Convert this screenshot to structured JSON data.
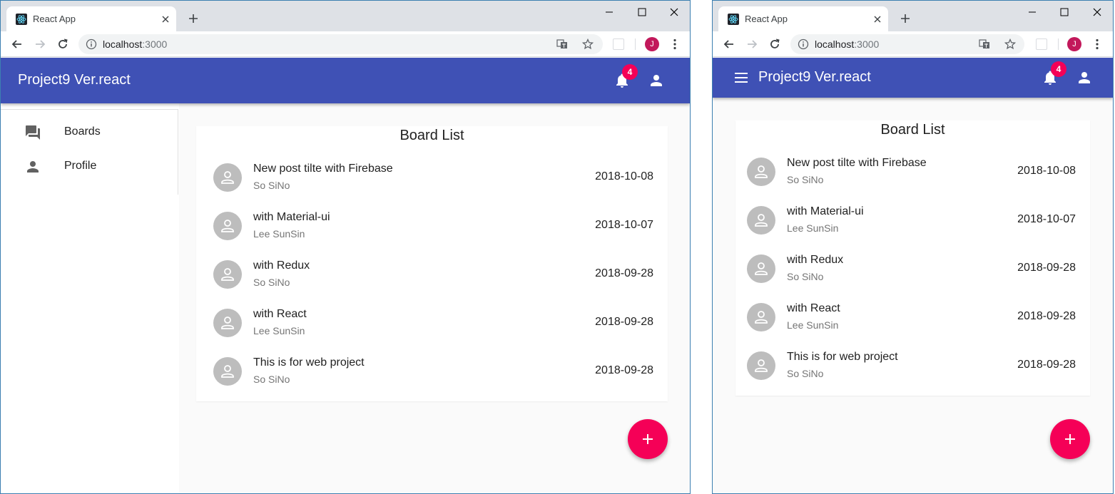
{
  "browser": {
    "tab_title": "React App",
    "url_host": "localhost",
    "url_port": ":3000",
    "profile_initial": "J"
  },
  "app": {
    "title": "Project9 Ver.react",
    "notification_count": "4",
    "primary_color": "#3f51b5",
    "accent_color": "#f50057"
  },
  "drawer": {
    "items": [
      {
        "label": "Boards",
        "icon": "forum-icon"
      },
      {
        "label": "Profile",
        "icon": "person-icon"
      }
    ]
  },
  "board": {
    "title": "Board List",
    "posts": [
      {
        "title": "New post tilte with Firebase",
        "author": "So SiNo",
        "date": "2018-10-08"
      },
      {
        "title": "with Material-ui",
        "author": "Lee SunSin",
        "date": "2018-10-07"
      },
      {
        "title": "with Redux",
        "author": "So SiNo",
        "date": "2018-09-28"
      },
      {
        "title": "with React",
        "author": "Lee SunSin",
        "date": "2018-09-28"
      },
      {
        "title": "This is for web project",
        "author": "So SiNo",
        "date": "2018-09-28"
      }
    ]
  },
  "fab": {
    "icon": "add-icon"
  }
}
